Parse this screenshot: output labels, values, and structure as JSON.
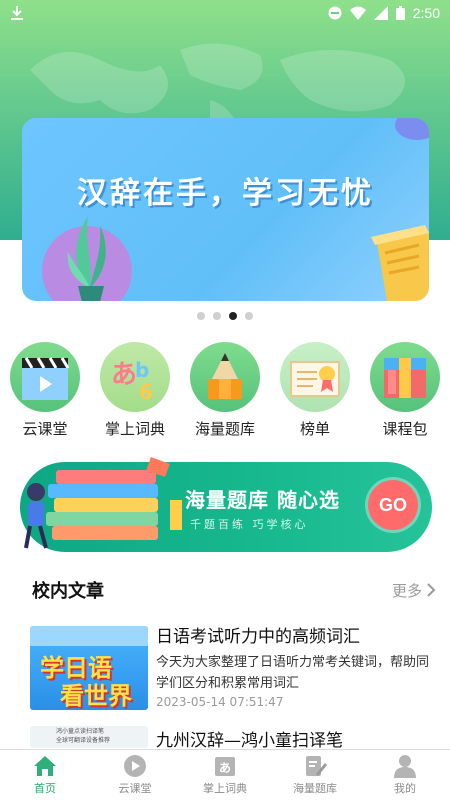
{
  "status_bar": {
    "time": "2:50"
  },
  "banner": {
    "slogan": "汉辞在手，学习无忧",
    "page_count": 4,
    "active_index": 2
  },
  "quick_nav": [
    {
      "label": "云课堂",
      "icon": "clapper-icon"
    },
    {
      "label": "掌上词典",
      "icon": "dictionary-icon"
    },
    {
      "label": "海量题库",
      "icon": "pencil-icon"
    },
    {
      "label": "榜单",
      "icon": "certificate-icon"
    },
    {
      "label": "课程包",
      "icon": "gift-box-icon"
    }
  ],
  "promo": {
    "title": "海量题库 随心选",
    "subtitle": "千题百练 巧学核心",
    "button": "GO"
  },
  "articles_section": {
    "title": "校内文章",
    "more": "更多"
  },
  "articles": [
    {
      "title": "日语考试听力中的高频词汇",
      "desc": "今天为大家整理了日语听力常考关键词，帮助同学们区分和积累常用词汇",
      "time": "2023-05-14 07:51:47",
      "thumb_text_1": "学日语",
      "thumb_text_2": "看世界"
    },
    {
      "title": "九州汉辞—鸿小童扫译笔",
      "thumb_line_1": "鸿小童点读扫译笔",
      "thumb_line_2": "全球可翻译设备推荐"
    }
  ],
  "tabbar": [
    {
      "label": "首页",
      "icon": "home-icon",
      "active": true
    },
    {
      "label": "云课堂",
      "icon": "play-icon",
      "active": false
    },
    {
      "label": "掌上词典",
      "icon": "dictionary-icon",
      "active": false
    },
    {
      "label": "海量题库",
      "icon": "edit-icon",
      "active": false
    },
    {
      "label": "我的",
      "icon": "user-icon",
      "active": false
    }
  ]
}
